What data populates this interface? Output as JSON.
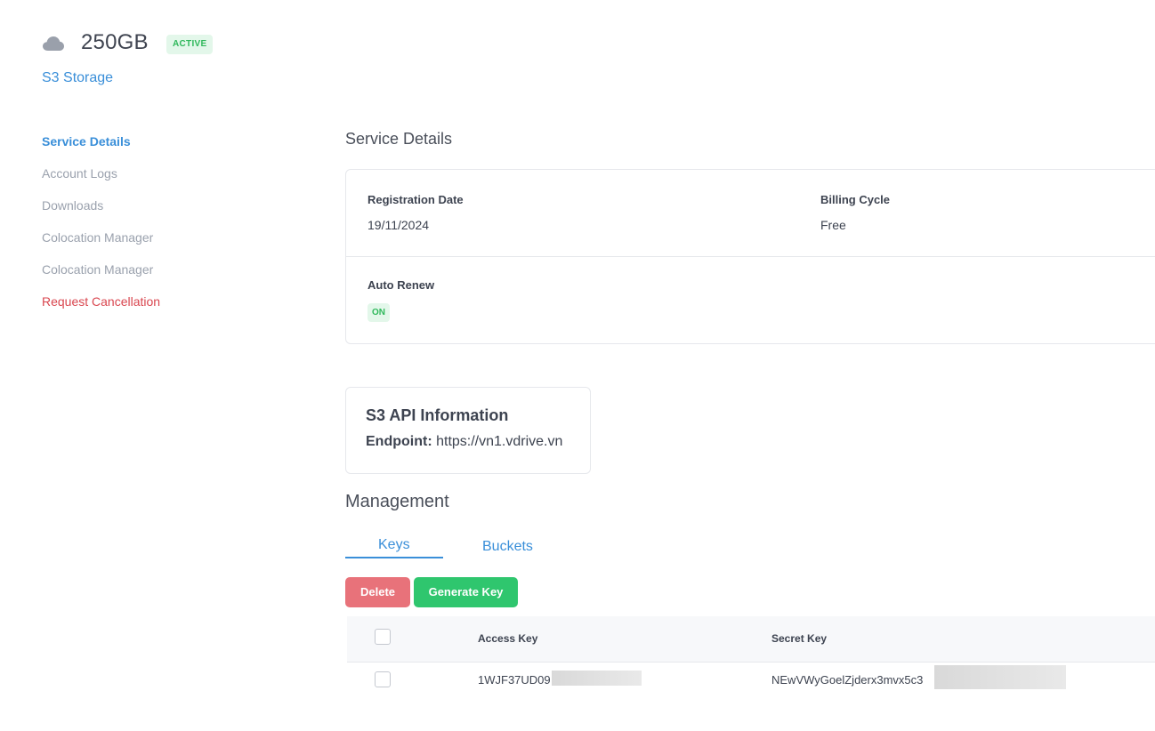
{
  "header": {
    "icon": "cloud-icon",
    "plan_size": "250GB",
    "status_badge": "ACTIVE",
    "product_name": "S3 Storage"
  },
  "sidebar": {
    "items": [
      {
        "label": "Service Details",
        "state": "active"
      },
      {
        "label": "Account Logs",
        "state": "normal"
      },
      {
        "label": "Downloads",
        "state": "normal"
      },
      {
        "label": "Colocation Manager",
        "state": "normal"
      },
      {
        "label": "Colocation Manager",
        "state": "normal"
      },
      {
        "label": "Request Cancellation",
        "state": "danger"
      }
    ]
  },
  "service_details": {
    "title": "Service Details",
    "registration_date_label": "Registration Date",
    "registration_date_value": "19/11/2024",
    "billing_cycle_label": "Billing Cycle",
    "billing_cycle_value": "Free",
    "auto_renew_label": "Auto Renew",
    "auto_renew_value": "ON"
  },
  "s3_api": {
    "title": "S3 API Information",
    "endpoint_label": "Endpoint:",
    "endpoint_value": "https://vn1.vdrive.vn"
  },
  "management": {
    "title": "Management",
    "tabs": [
      {
        "label": "Keys",
        "active": true
      },
      {
        "label": "Buckets",
        "active": false
      }
    ],
    "buttons": {
      "delete": "Delete",
      "generate_key": "Generate Key"
    },
    "table": {
      "columns": [
        "Access Key",
        "Secret Key"
      ],
      "rows": [
        {
          "access_key": "1WJF37UD09",
          "secret_key": "NEwVWyGoelZjderx3mvx5c3"
        }
      ]
    }
  },
  "colors": {
    "accent": "#3a8fd9",
    "success": "#2fb85b",
    "danger": "#d9464f",
    "delete_button": "#e8727a",
    "generate_button": "#2fc66e"
  }
}
